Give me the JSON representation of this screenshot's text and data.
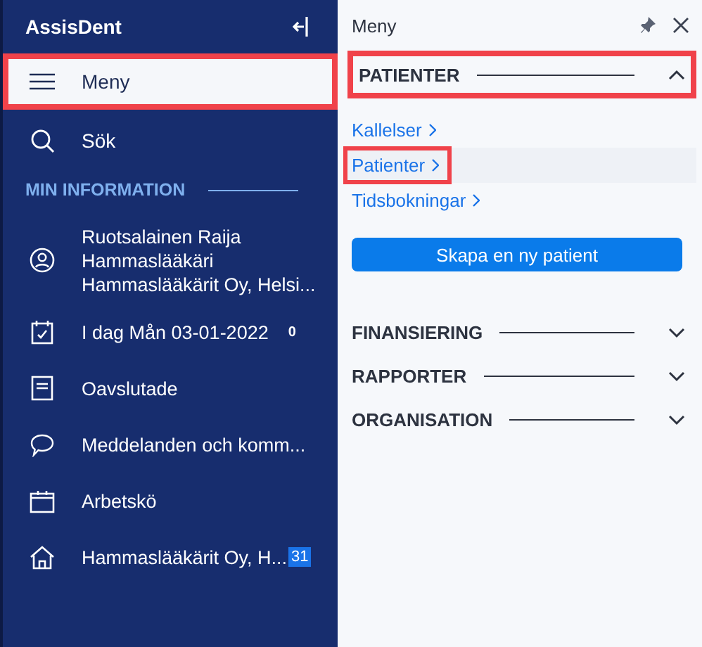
{
  "sidebar": {
    "title": "AssisDent",
    "nav": [
      {
        "label": "Meny",
        "selected": true,
        "highlighted": true
      },
      {
        "label": "Sök",
        "selected": false,
        "highlighted": false
      }
    ],
    "section_title": "MIN INFORMATION",
    "user": {
      "lines": [
        "Ruotsalainen Raija",
        "Hammaslääkäri",
        "Hammaslääkärit Oy, Helsi..."
      ]
    },
    "items": [
      {
        "label": "I dag Mån 03-01-2022",
        "count": "0",
        "kind": "count"
      },
      {
        "label": "Oavslutade"
      },
      {
        "label": "Meddelanden och komm..."
      },
      {
        "label": "Arbetskö"
      },
      {
        "label": "Hammaslääkärit Oy, H...",
        "count": "31",
        "kind": "badge"
      }
    ]
  },
  "panel": {
    "title": "Meny",
    "sections": [
      {
        "title": "PATIENTER",
        "expanded": true,
        "highlighted": true,
        "links": [
          {
            "label": "Kallelser",
            "highlighted": false
          },
          {
            "label": "Patienter",
            "highlighted": true
          },
          {
            "label": "Tidsbokningar",
            "highlighted": false
          }
        ],
        "button": "Skapa en ny patient"
      },
      {
        "title": "FINANSIERING",
        "expanded": false,
        "highlighted": false
      },
      {
        "title": "RAPPORTER",
        "expanded": false,
        "highlighted": false
      },
      {
        "title": "ORGANISATION",
        "expanded": false,
        "highlighted": false
      }
    ]
  }
}
